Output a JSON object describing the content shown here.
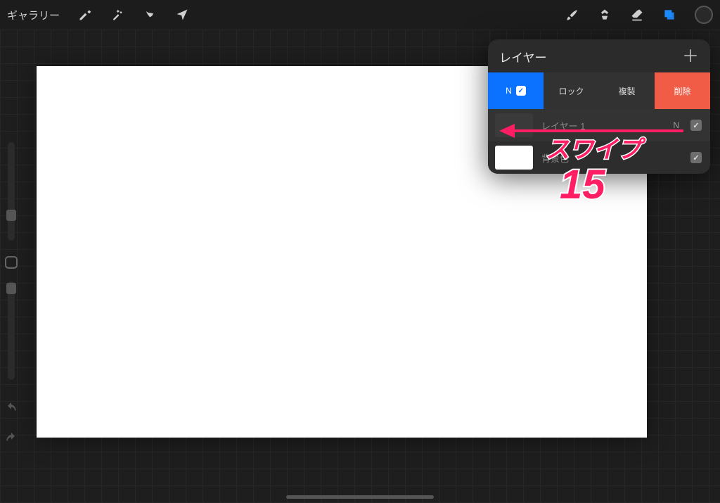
{
  "topbar": {
    "gallery_label": "ギャラリー"
  },
  "layers_panel": {
    "title": "レイヤー",
    "swipe_actions": {
      "blend_label": "N",
      "lock_label": "ロック",
      "duplicate_label": "複製",
      "delete_label": "削除"
    },
    "layers": [
      {
        "name": "レイヤー 1",
        "blend": "N",
        "visible": true,
        "thumb": "dark",
        "active": true
      },
      {
        "name": "背景色",
        "blend": "",
        "visible": true,
        "thumb": "white",
        "active": false
      }
    ]
  },
  "annotation": {
    "text": "スワイプ",
    "number": "15"
  }
}
